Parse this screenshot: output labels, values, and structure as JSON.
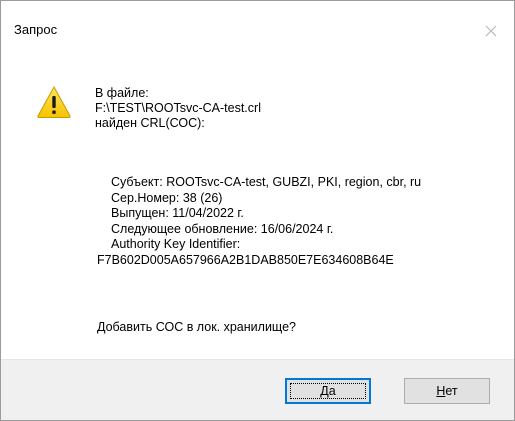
{
  "dialog": {
    "title": "Запрос",
    "close_icon": "close-icon",
    "icon": "warning-icon"
  },
  "message": {
    "line1": "В файле:",
    "line2": "F:\\TEST\\ROOTsvc-CA-test.crl",
    "line3": "найден CRL(СОС):"
  },
  "details": {
    "subject": "Субъект: ROOTsvc-CA-test, GUBZI, PKI, region, cbr, ru",
    "serial": "Сер.Номер: 38 (26)",
    "issued": "Выпущен: 11/04/2022 г.",
    "next_update": "Следующее обновление: 16/06/2024 г.",
    "aki_label": "Authority Key Identifier:",
    "aki_value": "F7B602D005A657966A2B1DAB850E7E634608B64E"
  },
  "question": "Добавить СОС в лок. хранилище?",
  "buttons": {
    "yes_accel": "Д",
    "yes_rest": "а",
    "no_accel": "Н",
    "no_rest": "ет"
  },
  "colors": {
    "focus_border": "#0078d7",
    "footer_bg": "#f0f0f0",
    "warning_yellow": "#ffd21f"
  }
}
